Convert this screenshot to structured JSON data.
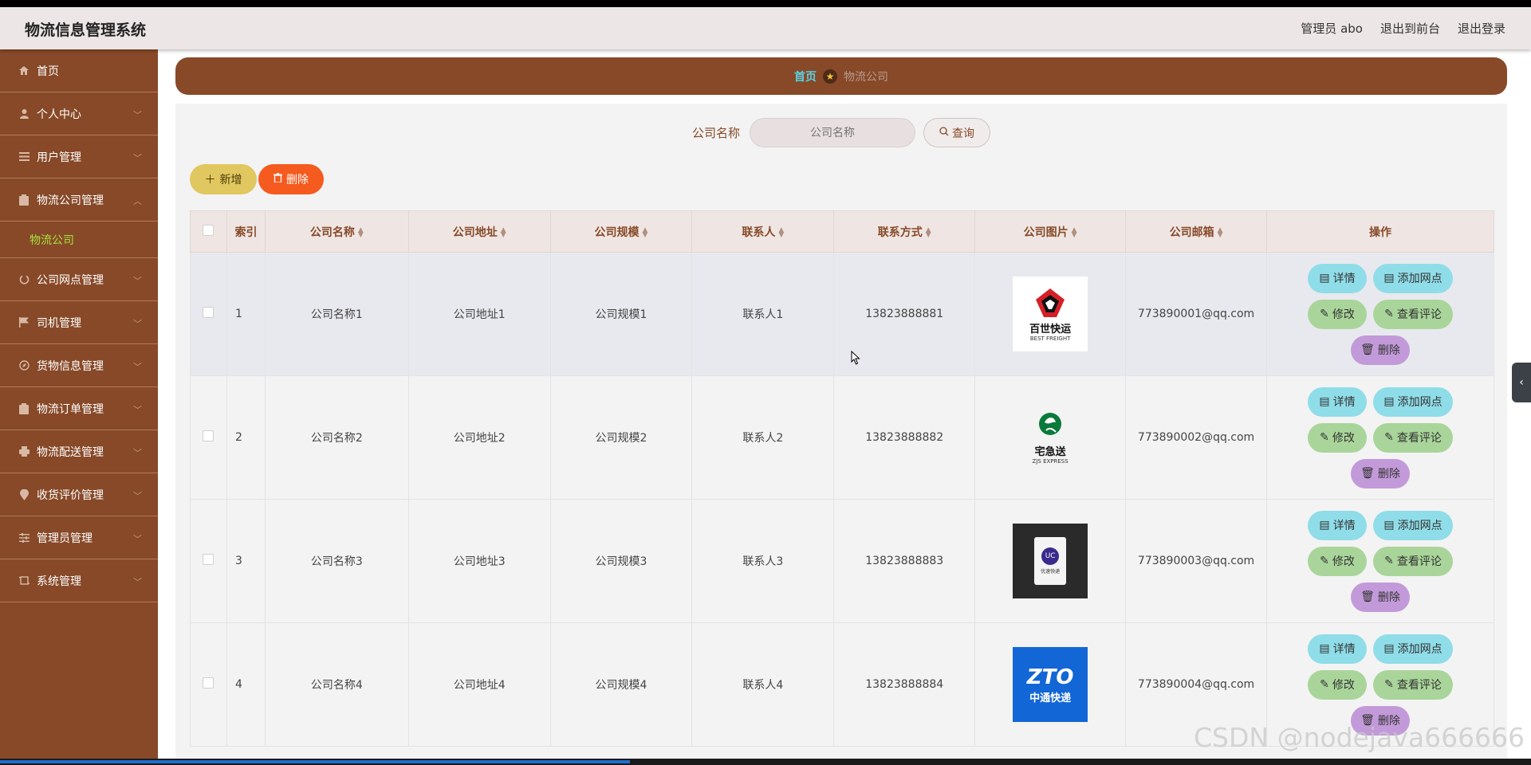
{
  "header": {
    "app_title": "物流信息管理系统",
    "admin_label": "管理员 abo",
    "to_front": "退出到前台",
    "logout": "退出登录"
  },
  "sidebar": {
    "items": [
      {
        "label": "首页",
        "icon": "home-icon"
      },
      {
        "label": "个人中心",
        "icon": "user-icon"
      },
      {
        "label": "用户管理",
        "icon": "list-icon"
      },
      {
        "label": "物流公司管理",
        "icon": "clipboard-icon"
      },
      {
        "label": "公司网点管理",
        "icon": "power-icon"
      },
      {
        "label": "司机管理",
        "icon": "flag-icon"
      },
      {
        "label": "货物信息管理",
        "icon": "compass-icon"
      },
      {
        "label": "物流订单管理",
        "icon": "clipboard-icon"
      },
      {
        "label": "物流配送管理",
        "icon": "printer-icon"
      },
      {
        "label": "收货评价管理",
        "icon": "pin-icon"
      },
      {
        "label": "管理员管理",
        "icon": "sliders-icon"
      },
      {
        "label": "系统管理",
        "icon": "crop-icon"
      }
    ],
    "active_submenu": "物流公司"
  },
  "breadcrumb": {
    "home": "首页",
    "current": "物流公司"
  },
  "search": {
    "label": "公司名称",
    "placeholder": "公司名称",
    "button": "查询"
  },
  "actions": {
    "add": "新增",
    "delete": "删除"
  },
  "table": {
    "headers": [
      "索引",
      "公司名称",
      "公司地址",
      "公司规模",
      "联系人",
      "联系方式",
      "公司图片",
      "公司邮箱",
      "操作"
    ],
    "rows": [
      {
        "index": "1",
        "name": "公司名称1",
        "address": "公司地址1",
        "scale": "公司规模1",
        "contact": "联系人1",
        "phone": "13823888881",
        "email": "773890001@qq.com",
        "logo_text": "百世快运",
        "logo_sub": "BEST FREIGHT"
      },
      {
        "index": "2",
        "name": "公司名称2",
        "address": "公司地址2",
        "scale": "公司规模2",
        "contact": "联系人2",
        "phone": "13823888882",
        "email": "773890002@qq.com",
        "logo_text": "宅急送",
        "logo_sub": "ZJS EXPRESS"
      },
      {
        "index": "3",
        "name": "公司名称3",
        "address": "公司地址3",
        "scale": "公司规模3",
        "contact": "联系人3",
        "phone": "13823888883",
        "email": "773890003@qq.com",
        "logo_text": "优速快递",
        "logo_sub": ""
      },
      {
        "index": "4",
        "name": "公司名称4",
        "address": "公司地址4",
        "scale": "公司规模4",
        "contact": "联系人4",
        "phone": "13823888884",
        "email": "773890004@qq.com",
        "logo_text": "中通快递",
        "logo_sub": "ZTO"
      }
    ],
    "op_labels": {
      "detail": "详情",
      "add_point": "添加网点",
      "edit": "修改",
      "review": "查看评论",
      "delete": "删除"
    }
  },
  "watermark": "CSDN @nodejava666666",
  "colors": {
    "sidebar": "#874928",
    "breadcrumb_home": "#57d2e3",
    "active_submenu": "#a5e23f",
    "add_button": "#e1c75f",
    "delete_button": "#f55a1e"
  }
}
